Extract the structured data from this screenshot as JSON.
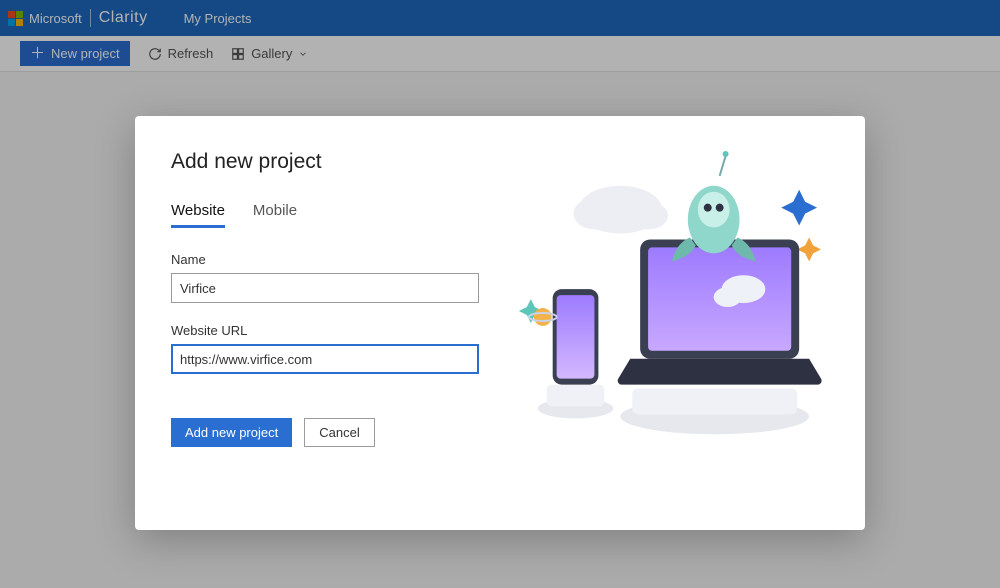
{
  "header": {
    "brand_ms": "Microsoft",
    "brand_product": "Clarity",
    "nav_my_projects": "My Projects"
  },
  "toolbar": {
    "new_project_label": "New project",
    "refresh_label": "Refresh",
    "gallery_label": "Gallery"
  },
  "modal": {
    "title": "Add new project",
    "tabs": {
      "website": "Website",
      "mobile": "Mobile"
    },
    "name_label": "Name",
    "name_value": "Virfice",
    "url_label": "Website URL",
    "url_value": "https://www.virfice.com",
    "submit_label": "Add new project",
    "cancel_label": "Cancel"
  }
}
